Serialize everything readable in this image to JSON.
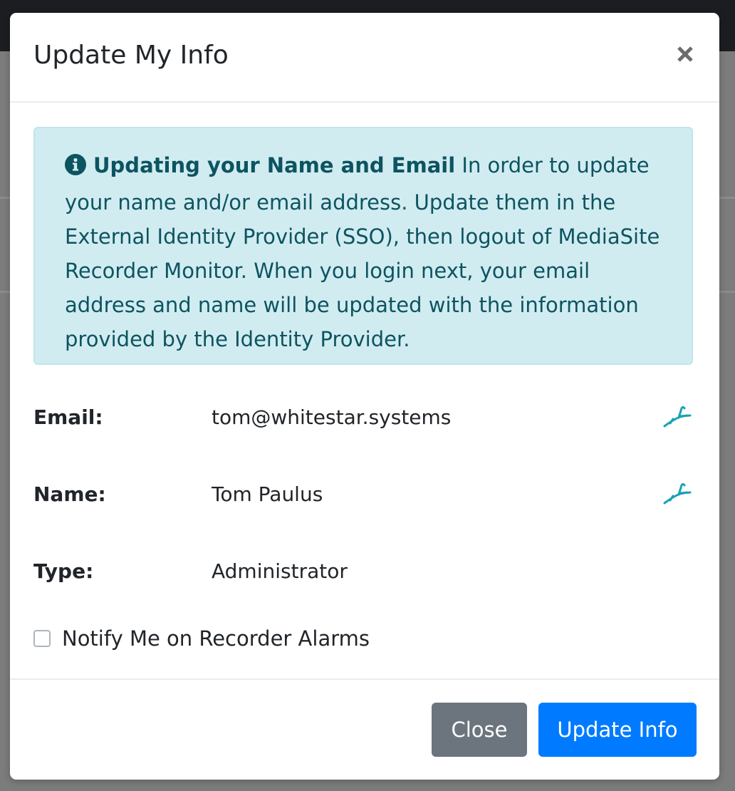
{
  "modal": {
    "title": "Update My Info",
    "close_icon": "close-icon"
  },
  "alert": {
    "icon": "info-circle-icon",
    "heading": "Updating your Name and Email",
    "body": "In order to update your name and/or email address. Update them in the External Identity Provider (SSO), then logout of MediaSite Recorder Monitor. When you login next, your email address and name will be updated with the information provided by the Identity Provider."
  },
  "fields": {
    "email": {
      "label": "Email:",
      "value": "tom@whitestar.systems",
      "edit_icon": "edit-sign-icon"
    },
    "name": {
      "label": "Name:",
      "value": "Tom Paulus",
      "edit_icon": "edit-sign-icon"
    },
    "type": {
      "label": "Type:",
      "value": "Administrator"
    }
  },
  "notify": {
    "label": "Notify Me on Recorder Alarms",
    "checked": false
  },
  "footer": {
    "close_label": "Close",
    "update_label": "Update Info"
  },
  "colors": {
    "alert_background": "#d1ecf1",
    "alert_text": "#0c5460",
    "edit_icon": "#17a2b8",
    "close_button": "#6c757d",
    "primary_button": "#007bff"
  }
}
